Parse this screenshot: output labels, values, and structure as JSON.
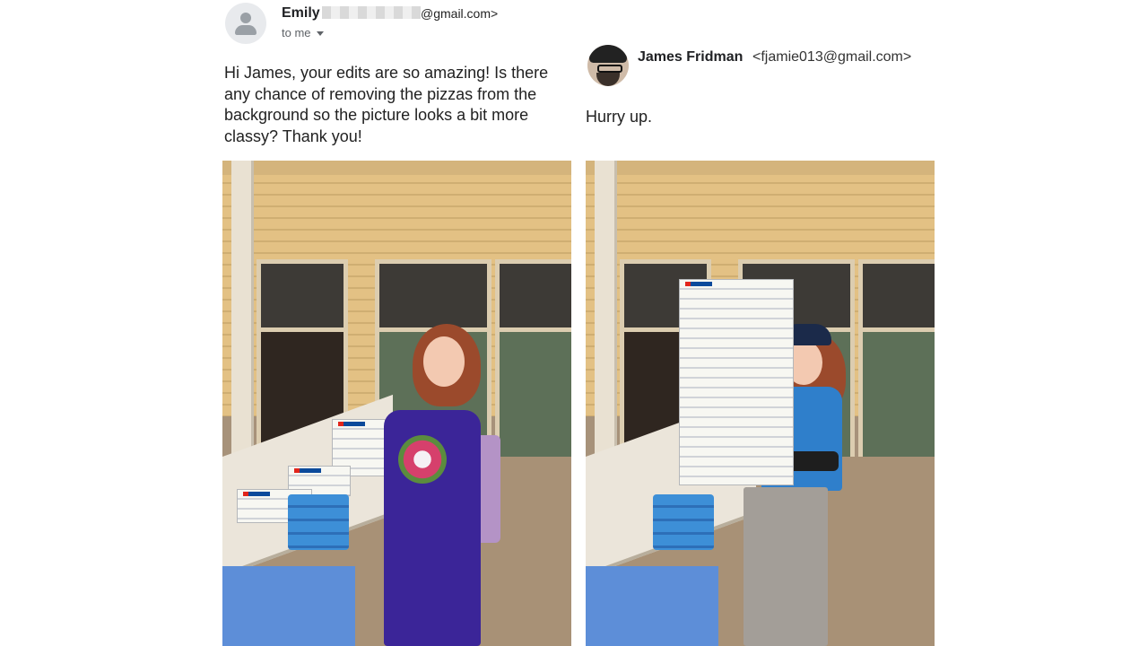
{
  "emily_email": {
    "sender_name": "Emily",
    "sender_email_suffix": "@gmail.com>",
    "to_label": "to me",
    "body": "Hi James, your edits are so amazing! Is there any chance of removing the pizzas from the background so the picture looks a bit more classy? Thank you!"
  },
  "james_email": {
    "sender_name": "James Fridman",
    "sender_email": "<fjamie013@gmail.com>",
    "body": "Hurry up."
  },
  "icons": {
    "default_avatar": "person-silhouette-icon",
    "dropdown": "caret-down-icon"
  },
  "colors": {
    "page_background": "#ffffff",
    "text": "#202124",
    "secondary_text": "#5f6368",
    "dress": "#3b2598",
    "uniform_shirt": "#2f7fcb",
    "tablecloth": "#5d8ed8"
  }
}
